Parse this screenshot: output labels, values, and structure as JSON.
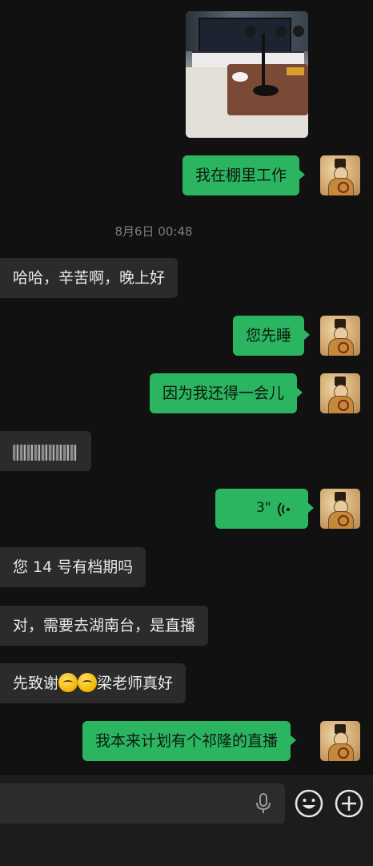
{
  "messages": {
    "m1": "我在棚里工作",
    "timestamp": "8月6日 00:48",
    "m2": "哈哈，辛苦啊，晚上好",
    "m3": "您先睡",
    "m4": "因为我还得一会儿",
    "m6_duration": "3\"",
    "m7": "您 14 号有档期吗",
    "m8": "对，需要去湖南台，是直播",
    "m9_part1": "先致谢",
    "m9_part2": "梁老师真好",
    "m10": "我本来计划有个祁隆的直播"
  },
  "colors": {
    "outgoing": "#2bb561",
    "incoming": "#2b2b2b",
    "background": "#111111"
  },
  "icons": [
    "photo-message",
    "avatar",
    "voice-wave-icon",
    "thinking-emoji",
    "microphone-icon",
    "emoji-icon",
    "plus-icon"
  ]
}
